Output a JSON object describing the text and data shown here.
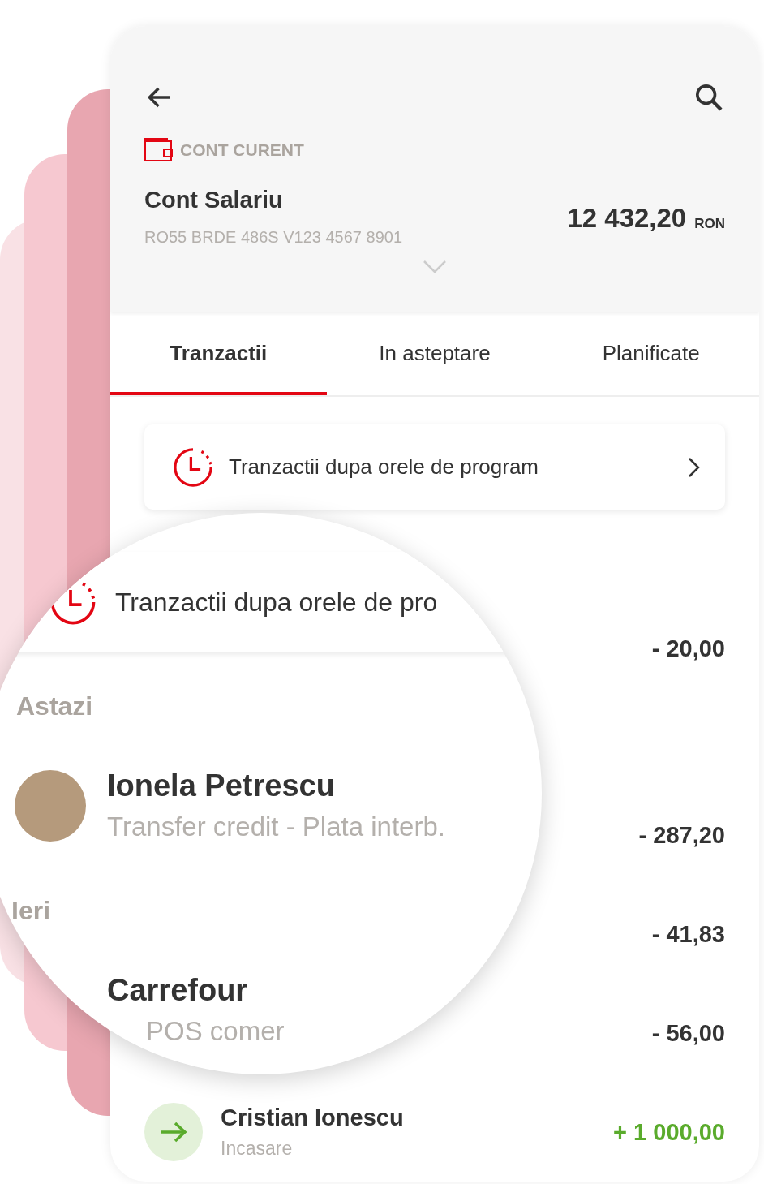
{
  "header": {
    "account_type": "CONT CURENT",
    "account_name": "Cont Salariu",
    "iban": "RO55 BRDE 486S V123 4567 8901",
    "balance": "12 432,20",
    "currency": "RON"
  },
  "tabs": [
    {
      "label": "Tranzactii",
      "selected": true
    },
    {
      "label": "In asteptare",
      "selected": false
    },
    {
      "label": "Planificate",
      "selected": false
    }
  ],
  "banner": {
    "text": "Tranzactii dupa orele de program"
  },
  "transactions": [
    {
      "kind": "debit",
      "amount": "- 20,00"
    },
    {
      "kind": "debit",
      "amount": "- 287,20"
    },
    {
      "kind": "debit",
      "amount": "- 41,83"
    },
    {
      "kind": "debit",
      "amount": "- 56,00"
    },
    {
      "kind": "credit",
      "name": "Cristian Ionescu",
      "subtitle": "Incasare",
      "amount": "+ 1 000,00"
    }
  ],
  "magnifier": {
    "banner_text": "Tranzactii dupa orele de pro",
    "sections": [
      {
        "title": "Astazi",
        "rows": [
          {
            "kind": "person",
            "name": "Ionela Petrescu",
            "subtitle": "Transfer credit - Plata interb."
          }
        ]
      },
      {
        "title": "Ieri",
        "rows": [
          {
            "kind": "merchant",
            "name": "Carrefour",
            "subtitle": "POS comer"
          }
        ]
      }
    ]
  }
}
